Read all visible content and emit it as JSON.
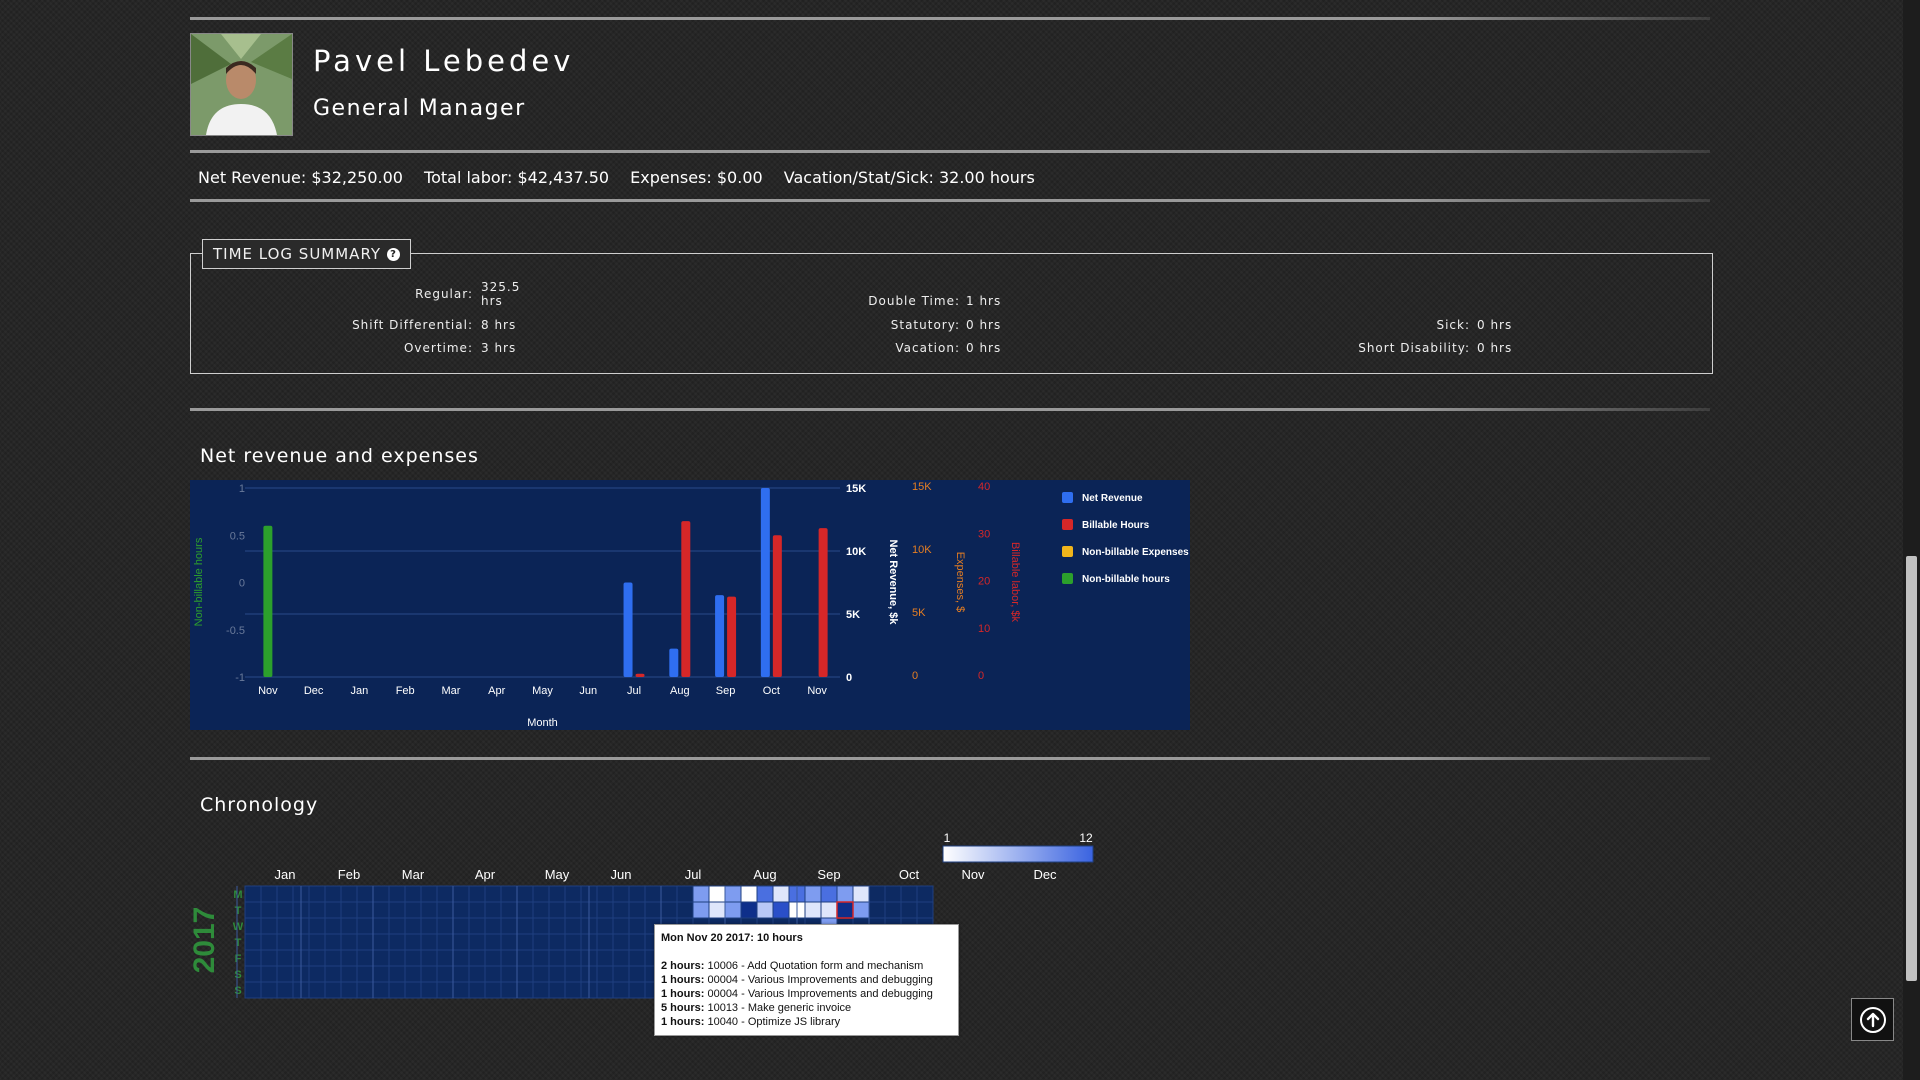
{
  "profile": {
    "name": "Pavel Lebedev",
    "role": "General Manager"
  },
  "stats": {
    "net_revenue": "Net Revenue: $32,250.00",
    "total_labor": "Total labor: $42,437.50",
    "expenses": "Expenses: $0.00",
    "vacation": "Vacation/Stat/Sick: 32.00 hours"
  },
  "timelog": {
    "title": "TIME LOG SUMMARY",
    "items": [
      {
        "label": "Regular:",
        "value": "325.5 hrs"
      },
      {
        "label": "Shift Differential:",
        "value": "8 hrs"
      },
      {
        "label": "Overtime:",
        "value": "3 hrs"
      },
      {
        "label": "Double Time:",
        "value": "1 hrs"
      },
      {
        "label": "Statutory:",
        "value": "0 hrs"
      },
      {
        "label": "Vacation:",
        "value": "0 hrs"
      },
      {
        "label": "Sick:",
        "value": "0 hrs"
      },
      {
        "label": "Short Disability:",
        "value": "0 hrs"
      }
    ]
  },
  "sections": {
    "revenue_title": "Net revenue and expenses",
    "chronology_title": "Chronology"
  },
  "chart_data": {
    "type": "bar",
    "categories": [
      "Nov",
      "Dec",
      "Jan",
      "Feb",
      "Mar",
      "Apr",
      "May",
      "Jun",
      "Jul",
      "Aug",
      "Sep",
      "Oct",
      "Nov"
    ],
    "xlabel": "Month",
    "axes": {
      "nonbillable": {
        "label": "Non-billable hours",
        "range": [
          -1,
          1
        ],
        "ticks": [
          "1",
          "0.5",
          "0",
          "-0.5",
          "-1"
        ],
        "color": "#2ca02c"
      },
      "revenue": {
        "label": "Net Revenue, $k",
        "range": [
          0,
          15000
        ],
        "ticks": [
          "15K",
          "10K",
          "5K",
          "0"
        ],
        "color": "#ffffff"
      },
      "expenses": {
        "label": "Expenses, $",
        "range": [
          0,
          15000
        ],
        "ticks": [
          "15K",
          "10K",
          "5K",
          "0"
        ],
        "color": "#e67e22"
      },
      "billable": {
        "label": "Billable labor, $k",
        "range": [
          0,
          40
        ],
        "ticks": [
          "40",
          "30",
          "20",
          "10",
          "0"
        ],
        "color": "#d62728"
      }
    },
    "series": [
      {
        "name": "Net Revenue",
        "color": "#2f6ef0",
        "axis": "revenue",
        "values": [
          0,
          0,
          0,
          0,
          0,
          0,
          0,
          0,
          7500,
          2250,
          6500,
          15000,
          0
        ]
      },
      {
        "name": "Billable Hours",
        "color": "#d62728",
        "axis": "billable",
        "values": [
          0,
          0,
          0,
          0,
          0,
          0,
          0,
          0,
          0.7,
          33,
          17,
          30,
          31.5
        ]
      },
      {
        "name": "Non-billable Expenses",
        "color": "#f1b51b",
        "axis": "expenses",
        "values": [
          0,
          0,
          0,
          0,
          0,
          0,
          0,
          0,
          0,
          0,
          0,
          0,
          0
        ]
      },
      {
        "name": "Non-billable hours",
        "color": "#2ca02c",
        "axis": "nonbillable",
        "values": [
          0.6,
          0,
          0,
          0,
          0,
          0,
          0,
          0,
          0,
          0,
          0,
          0,
          0
        ]
      }
    ],
    "legend_position": "right"
  },
  "chronology": {
    "year": "2017",
    "months": [
      "Jan",
      "Feb",
      "Mar",
      "Apr",
      "May",
      "Jun",
      "Jul",
      "Aug",
      "Sep",
      "Oct",
      "Nov",
      "Dec"
    ],
    "weekdays": [
      "M",
      "T",
      "W",
      "T",
      "F",
      "S",
      "S"
    ],
    "scale_min": "1",
    "scale_max": "12",
    "tooltip": {
      "title": "Mon Nov 20 2017: 10 hours",
      "lines": [
        {
          "h": "2 hours:",
          "t": " 10006 - Add Quotation form and mechanism"
        },
        {
          "h": "1 hours:",
          "t": " 00004 - Various Improvements and debugging"
        },
        {
          "h": "1 hours:",
          "t": " 00004 - Various Improvements and debugging"
        },
        {
          "h": "5 hours:",
          "t": " 10013 - Make generic invoice"
        },
        {
          "h": "1 hours:",
          "t": " 10040 - Optimize JS library"
        }
      ]
    }
  },
  "colors": {
    "chart_bg": "#0b2456",
    "cal_empty": "#0d2a62",
    "accent_green": "#2e8b3a"
  }
}
